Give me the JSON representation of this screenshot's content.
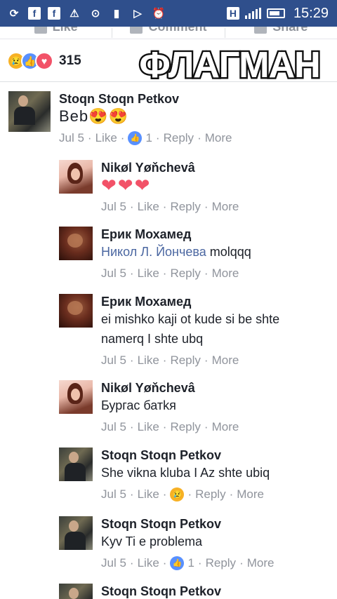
{
  "statusbar": {
    "time": "15:29",
    "h_label": "H",
    "icons": [
      "sync-icon",
      "facebook-icon",
      "facebook-icon",
      "warning-icon",
      "download-icon",
      "sd-card-icon",
      "play-store-icon",
      "alarm-icon",
      "h-network-icon",
      "signal-icon",
      "battery-icon"
    ]
  },
  "actions": {
    "like": "Like",
    "comment": "Comment",
    "share": "Share"
  },
  "reactions": {
    "count": "315",
    "types": [
      "sad",
      "like",
      "love"
    ]
  },
  "logo_text": "ФЛАГМАН",
  "comments": [
    {
      "author": "Stoqn Stoqn Petkov",
      "text": "Beb😍😍",
      "date": "Jul 5",
      "like": "Like",
      "likes": "1",
      "reply": "Reply",
      "more": "More"
    },
    {
      "author": "Nikøl Yøňchevâ",
      "text": "❤❤❤",
      "date": "Jul 5",
      "like": "Like",
      "reply": "Reply",
      "more": "More"
    },
    {
      "author": "Ерик Мохамед",
      "mention": "Никол Л. Йончева",
      "text": "molqqq",
      "date": "Jul 5",
      "like": "Like",
      "reply": "Reply",
      "more": "More"
    },
    {
      "author": "Ерик Мохамед",
      "text_line1": "ei mishko kaji ot kude si be shte",
      "text_line2": "namerq I shte ubq",
      "date": "Jul 5",
      "like": "Like",
      "reply": "Reply",
      "more": "More"
    },
    {
      "author": "Nikøl Yøňchevâ",
      "text": "Бургас батkя",
      "date": "Jul 5",
      "like": "Like",
      "reply": "Reply",
      "more": "More"
    },
    {
      "author": "Stoqn Stoqn Petkov",
      "text": "She vikna kluba I Az shte ubiq",
      "date": "Jul 5",
      "like": "Like",
      "reply": "Reply",
      "more": "More"
    },
    {
      "author": "Stoqn Stoqn Petkov",
      "text": "Kyv Ti e problema",
      "date": "Jul 5",
      "like": "Like",
      "likes": "1",
      "reply": "Reply",
      "more": "More"
    },
    {
      "author": "Stoqn Stoqn Petkov"
    }
  ]
}
